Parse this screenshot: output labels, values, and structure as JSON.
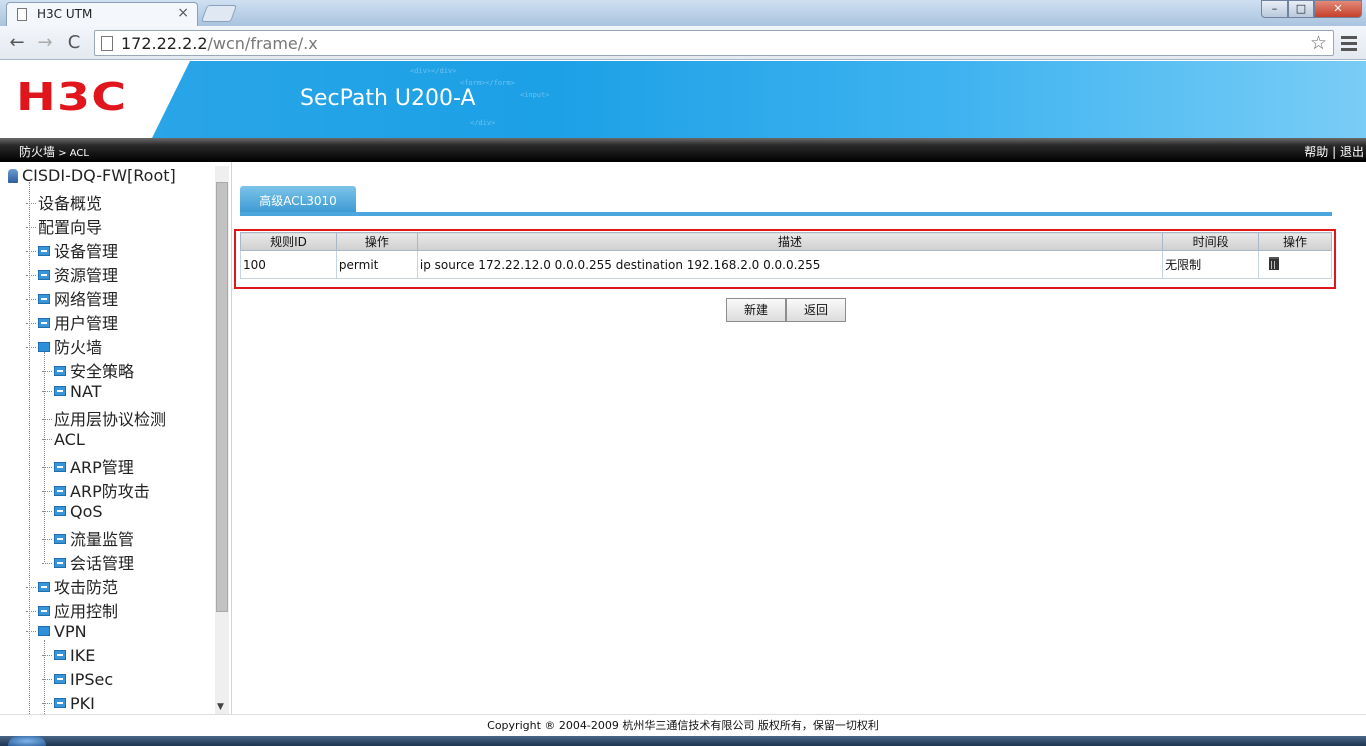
{
  "browser": {
    "tab_title": "H3C UTM",
    "tab_close": "×",
    "url_host": "172.22.2.2",
    "url_path": "/wcn/frame/.x",
    "win_min": "–",
    "win_max": "□",
    "win_close": "✕",
    "nav_back": "←",
    "nav_forward": "→",
    "nav_reload": "C",
    "bookmark_star": "☆"
  },
  "header": {
    "logo_text": "H3C",
    "product": "SecPath U200-A"
  },
  "crumbbar": {
    "breadcrumb_main": "防火墙",
    "breadcrumb_sep": " > ",
    "breadcrumb_sub": "ACL",
    "help": "帮助",
    "divider": " | ",
    "logout": "退出"
  },
  "sidebar": {
    "root": "CISDI-DQ-FW[Root]",
    "items": [
      {
        "label": "设备概览",
        "level": 1,
        "folder": false
      },
      {
        "label": "配置向导",
        "level": 1,
        "folder": false
      },
      {
        "label": "设备管理",
        "level": 1,
        "folder": true
      },
      {
        "label": "资源管理",
        "level": 1,
        "folder": true
      },
      {
        "label": "网络管理",
        "level": 1,
        "folder": true
      },
      {
        "label": "用户管理",
        "level": 1,
        "folder": true
      },
      {
        "label": "防火墙",
        "level": 1,
        "folder": true,
        "open": true
      },
      {
        "label": "安全策略",
        "level": 2,
        "folder": true
      },
      {
        "label": "NAT",
        "level": 2,
        "folder": true
      },
      {
        "label": "应用层协议检测",
        "level": 2,
        "folder": false
      },
      {
        "label": "ACL",
        "level": 2,
        "folder": false
      },
      {
        "label": "ARP管理",
        "level": 2,
        "folder": true
      },
      {
        "label": "ARP防攻击",
        "level": 2,
        "folder": true
      },
      {
        "label": "QoS",
        "level": 2,
        "folder": true
      },
      {
        "label": "流量监管",
        "level": 2,
        "folder": true
      },
      {
        "label": "会话管理",
        "level": 2,
        "folder": true
      },
      {
        "label": "攻击防范",
        "level": 1,
        "folder": true
      },
      {
        "label": "应用控制",
        "level": 1,
        "folder": true
      },
      {
        "label": "VPN",
        "level": 1,
        "folder": true,
        "open": true
      },
      {
        "label": "IKE",
        "level": 2,
        "folder": true
      },
      {
        "label": "IPSec",
        "level": 2,
        "folder": true
      },
      {
        "label": "PKI",
        "level": 2,
        "folder": true
      }
    ],
    "scroll_down": "▼"
  },
  "main": {
    "tab_label": "高级ACL3010",
    "table": {
      "columns": [
        "规则ID",
        "操作",
        "描述",
        "时间段",
        "操作"
      ],
      "rows": [
        {
          "id": "100",
          "action": "permit",
          "description": "ip source 172.22.12.0 0.0.0.255 destination 192.168.2.0 0.0.0.255",
          "time_range": "无限制",
          "op_icon": "trash-icon"
        }
      ]
    },
    "new_button": "新建",
    "back_button": "返回"
  },
  "footer": {
    "copyright": "Copyright ® 2004-2009 杭州华三通信技术有限公司 版权所有，保留一切权利"
  },
  "colors": {
    "brand_red": "#e0161c",
    "banner_blue": "#1ca0e6",
    "highlight_box": "#e0161c"
  }
}
